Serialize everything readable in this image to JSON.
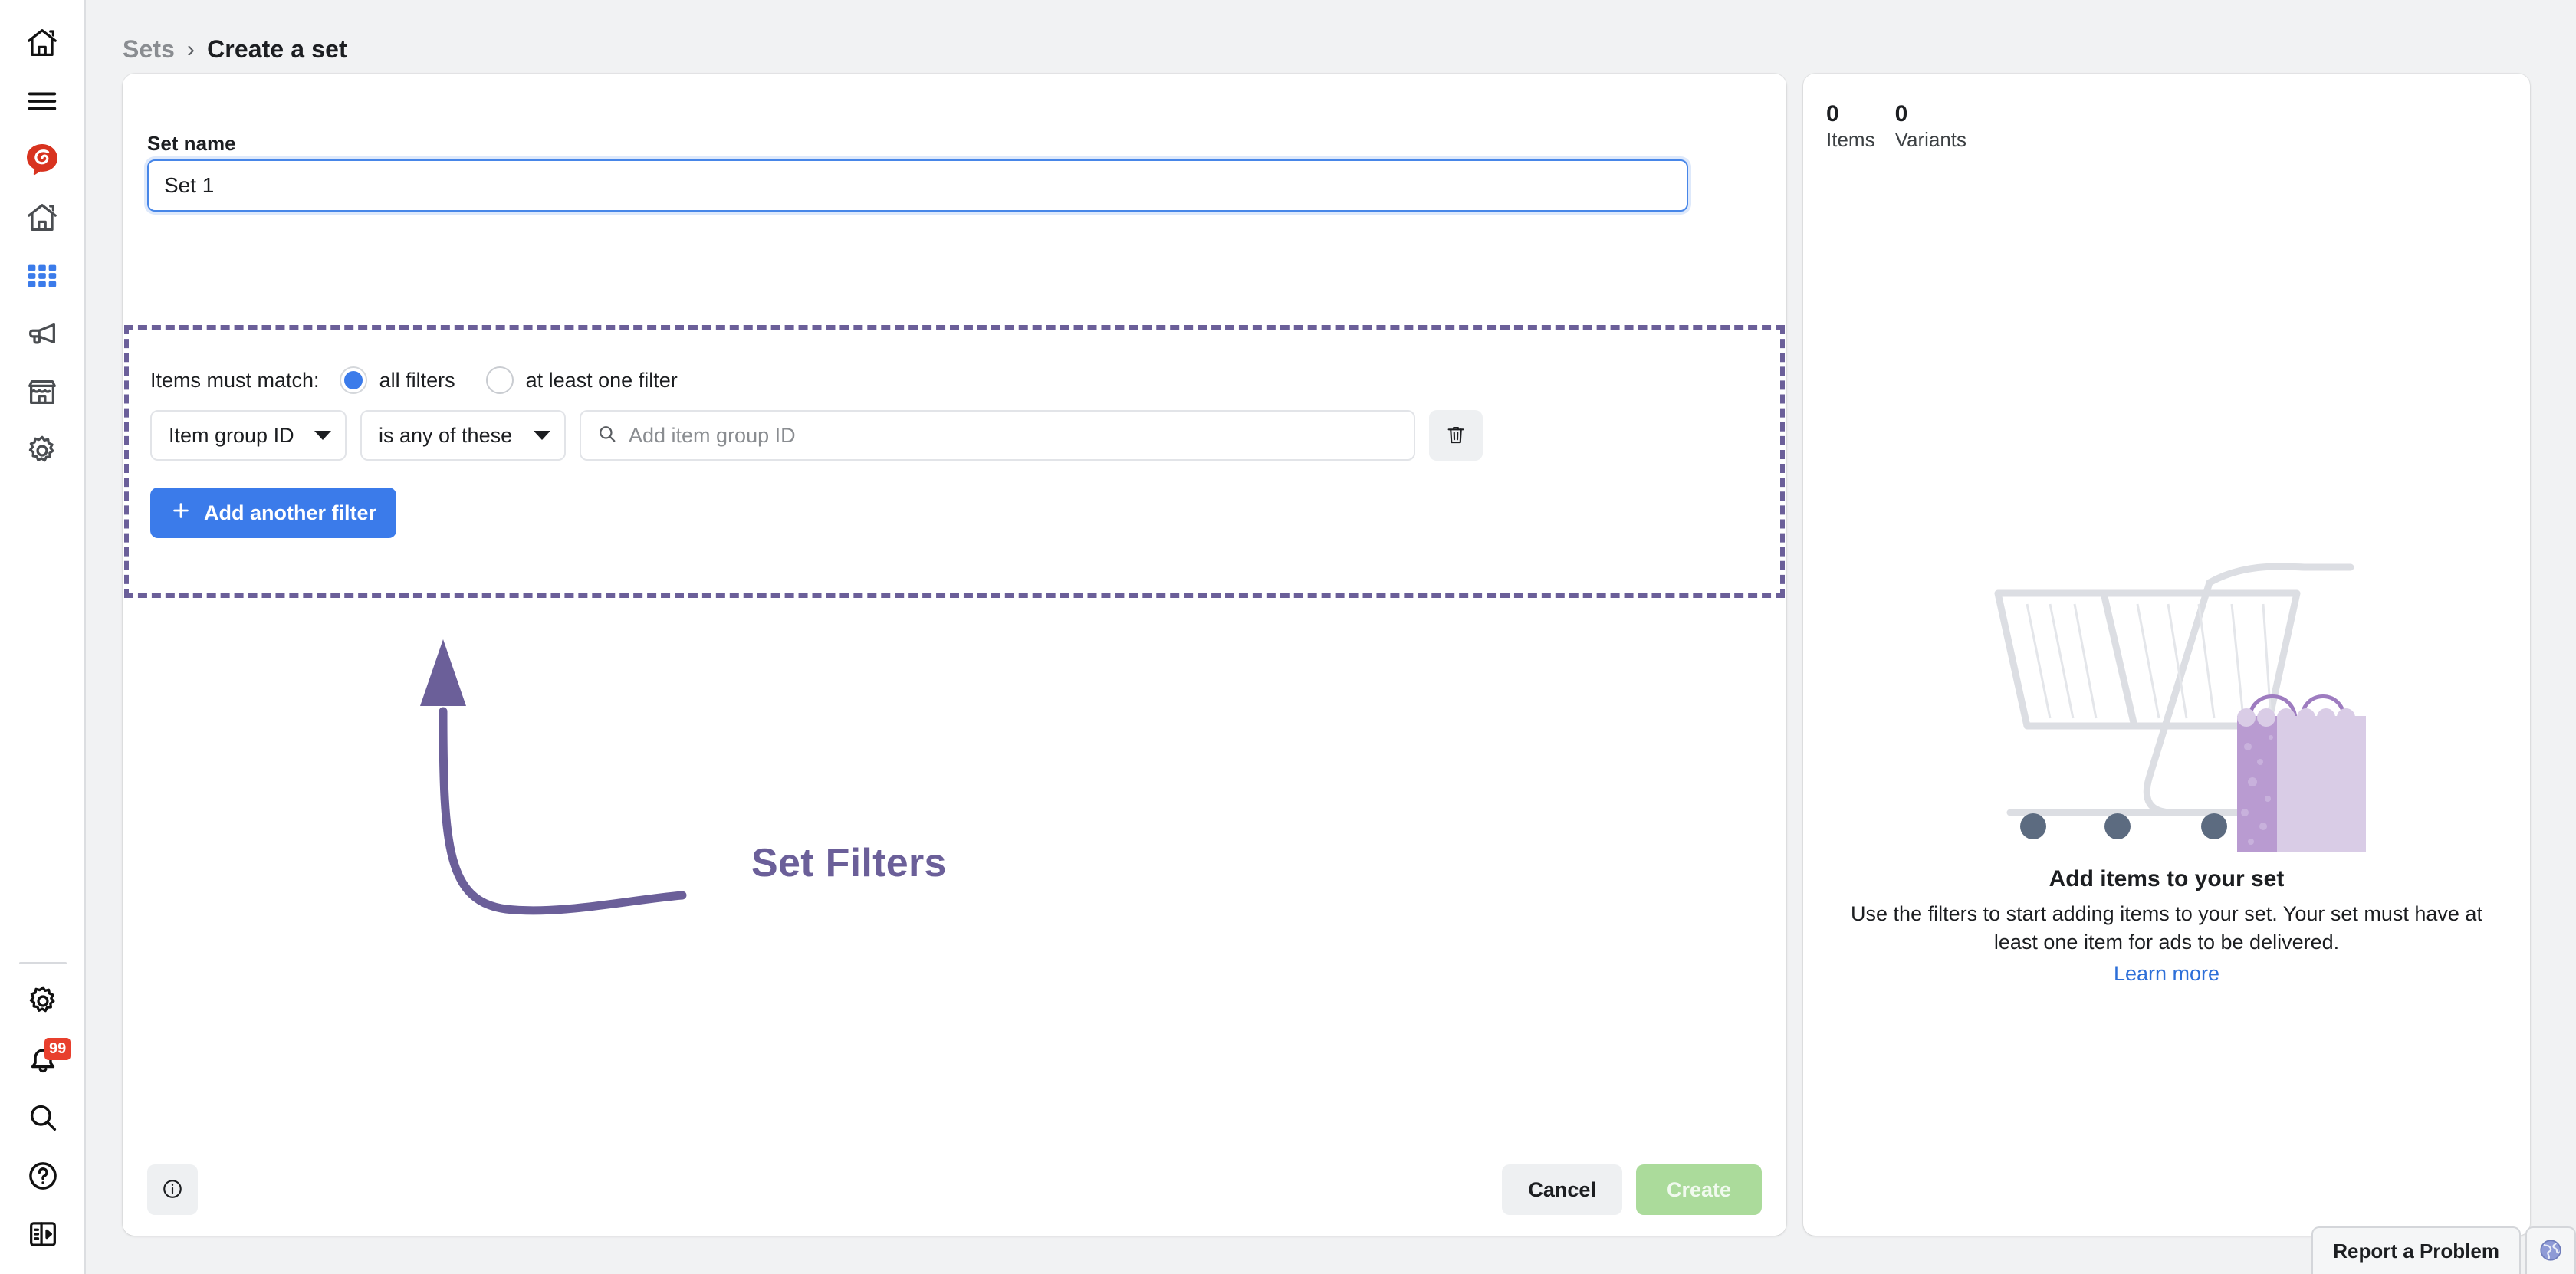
{
  "sidebar": {
    "top_items": [
      {
        "name": "home-outline-icon",
        "label": "Home"
      },
      {
        "name": "hamburger-menu-icon",
        "label": "Menu"
      },
      {
        "name": "meta-business-logo-icon",
        "label": "Business Suite"
      },
      {
        "name": "home-icon",
        "label": "Home"
      },
      {
        "name": "grid-apps-icon",
        "label": "All tools"
      },
      {
        "name": "megaphone-icon",
        "label": "Ads"
      },
      {
        "name": "storefront-icon",
        "label": "Commerce"
      },
      {
        "name": "gear-icon",
        "label": "Settings"
      }
    ],
    "bottom_items": [
      {
        "name": "gear-icon",
        "label": "Settings"
      },
      {
        "name": "bell-icon",
        "label": "Notifications",
        "badge": "99"
      },
      {
        "name": "search-icon",
        "label": "Search"
      },
      {
        "name": "help-circle-icon",
        "label": "Help"
      },
      {
        "name": "panel-toggle-icon",
        "label": "Toggle panel"
      }
    ]
  },
  "breadcrumb": {
    "parent": "Sets",
    "separator": "›",
    "current": "Create a set"
  },
  "form": {
    "set_name_label": "Set name",
    "set_name_value": "Set 1",
    "set_name_placeholder": "Set name"
  },
  "filters": {
    "match_label": "Items must match:",
    "options": [
      {
        "label": "all filters",
        "selected": true
      },
      {
        "label": "at least one filter",
        "selected": false
      }
    ],
    "rows": [
      {
        "field": "Item group ID",
        "operator": "is any of these",
        "value": "",
        "placeholder": "Add item group ID",
        "delete_icon": "trash-icon"
      }
    ],
    "add_filter_label": "Add another filter",
    "add_filter_icon": "plus-icon"
  },
  "annotation": {
    "label": "Set Filters",
    "color": "#6b5f99"
  },
  "footer": {
    "info_icon": "info-circle-icon",
    "cancel_label": "Cancel",
    "create_label": "Create"
  },
  "side_panel": {
    "stats": [
      {
        "value": "0",
        "caption": "Items"
      },
      {
        "value": "0",
        "caption": "Variants"
      }
    ],
    "empty_state": {
      "illustration": "shopping-cart-with-bag-illustration",
      "title": "Add items to your set",
      "description": "Use the filters to start adding items to your set. Your set must have at least one item for ads to be delivered.",
      "link_label": "Learn more"
    }
  },
  "report_bar": {
    "report_label": "Report a Problem",
    "globe_icon": "globe-icon"
  },
  "colors": {
    "accent_blue": "#3b7bea",
    "annotation_purple": "#6b5f99",
    "create_green": "#abdb9b",
    "badge_red": "#e8402e",
    "link_blue": "#2d6fd8",
    "page_bg": "#f1f2f3"
  }
}
